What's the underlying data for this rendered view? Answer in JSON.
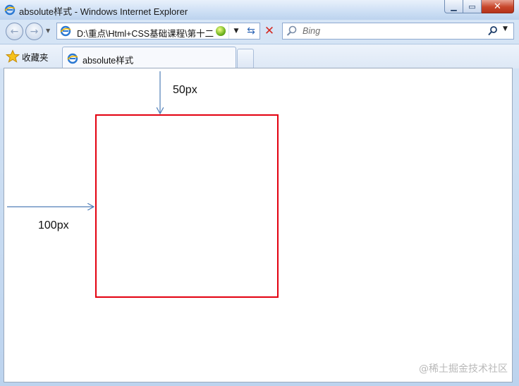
{
  "window": {
    "title": "absolute样式 - Windows Internet Explorer",
    "controls": {
      "minimize": "▁",
      "maximize": "▭",
      "close": "✕"
    }
  },
  "nav": {
    "address": "D:\\重点\\Html+CSS基础课程\\第十二",
    "search_placeholder": "Bing"
  },
  "tabs": {
    "favorites_label": "收藏夹",
    "active_tab_label": "absolute样式"
  },
  "content": {
    "top_offset_label": "50px",
    "left_offset_label": "100px",
    "box_border_color": "#e3000f",
    "arrow_color": "#4f7eb8",
    "watermark": "@稀土掘金技术社区"
  }
}
